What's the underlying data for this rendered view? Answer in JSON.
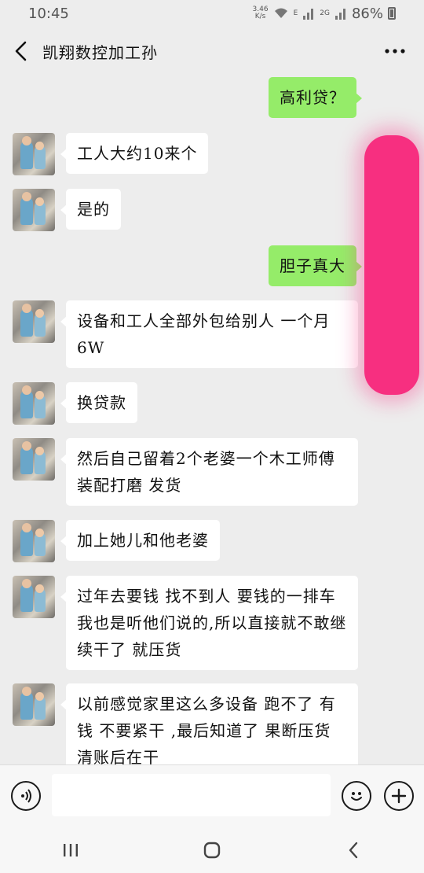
{
  "status_bar": {
    "time": "10:45",
    "net_speed_top": "3.46",
    "net_speed_bottom": "K/s",
    "signal_label": "E",
    "network_label": "2G",
    "battery": "86%"
  },
  "header": {
    "title": "凯翔数控加工孙",
    "back_icon": "chevron-left-icon",
    "more_icon": "more-dots-icon"
  },
  "messages": [
    {
      "side": "out",
      "text": "高利贷？"
    },
    {
      "side": "in",
      "text": "工人大约10来个"
    },
    {
      "side": "in",
      "text": "是的"
    },
    {
      "side": "out",
      "text": "胆子真大"
    },
    {
      "side": "in",
      "lines": [
        "设备和工人全部外包给别人 一个月",
        "6W"
      ]
    },
    {
      "side": "in",
      "text": "换贷款"
    },
    {
      "side": "in",
      "lines": [
        "然后自己留着2个老婆一个木工师傅",
        "装配打磨 发货"
      ]
    },
    {
      "side": "in",
      "text": "加上她儿和他老婆"
    },
    {
      "side": "in",
      "lines": [
        "过年去要钱 找不到人 要钱的一排车",
        "我也是听他们说的,所以直接就不敢继",
        "续干了 就压货"
      ]
    },
    {
      "side": "in",
      "lines": [
        "以前感觉家里这么多设备 跑不了 有",
        "钱 不要紧干 ,最后知道了 果断压货",
        "清账后在干"
      ]
    }
  ],
  "input_bar": {
    "placeholder": "",
    "voice_icon": "voice-icon",
    "emoji_icon": "emoji-icon",
    "plus_icon": "plus-icon"
  },
  "nav_bar": {
    "recent_icon": "recent-apps-icon",
    "home_icon": "home-icon",
    "back_icon": "back-icon"
  },
  "colors": {
    "background": "#ededed",
    "outgoing_bubble": "#95ec69",
    "incoming_bubble": "#ffffff",
    "redaction": "#f72f80"
  }
}
